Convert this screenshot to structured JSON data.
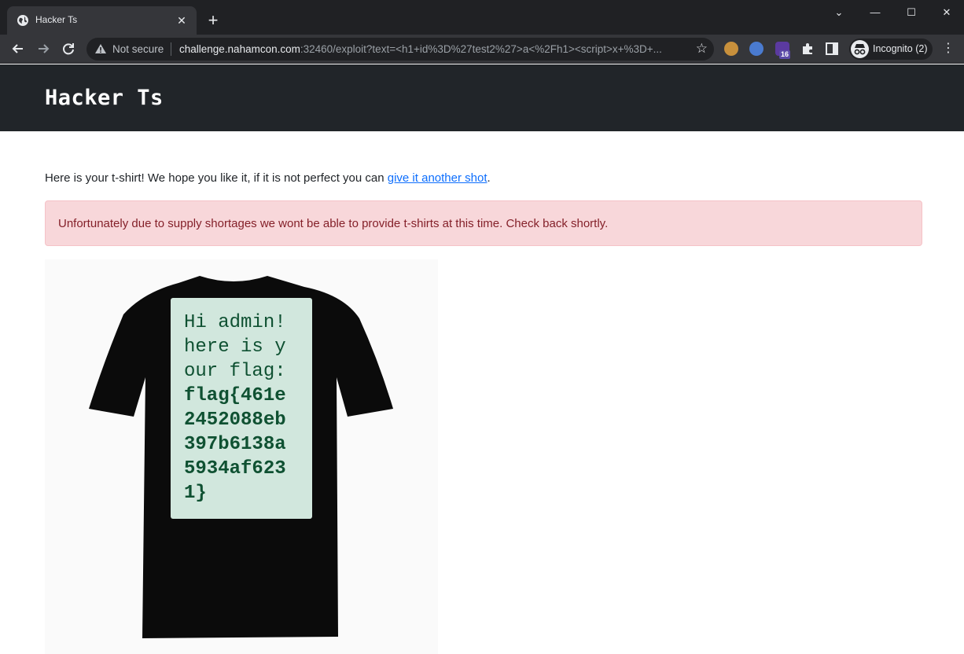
{
  "browser": {
    "tab_title": "Hacker Ts",
    "tab_close": "✕",
    "new_tab": "+",
    "window_controls": {
      "minimize": "—",
      "maximize": "☐",
      "close": "✕",
      "dropdown": "⌄"
    },
    "security_label": "Not secure",
    "url_host": "challenge.nahamcon.com",
    "url_rest": ":32460/exploit?text=<h1+id%3D%27test2%27>a<%2Fh1><script>x+%3D+...",
    "extension_badge": "16",
    "profile_label": "Incognito (2)",
    "icons": [
      "globe-icon",
      "back-arrow-icon",
      "forward-arrow-icon",
      "reload-icon",
      "warning-icon",
      "star-icon",
      "cookie-extension-icon",
      "globe-extension-icon",
      "hat-extension-icon",
      "puzzle-icon",
      "side-panel-icon",
      "incognito-icon",
      "menu-dots-icon"
    ]
  },
  "page": {
    "brand": "Hacker Ts",
    "intro_text": "Here is your t-shirt! We hope you like it, if it is not perfect you can ",
    "intro_link": "give it another shot",
    "intro_end": ".",
    "alert": "Unfortunately due to supply shortages we wont be able to provide t-shirts at this time. Check back shortly.",
    "shirt_lines": [
      "Hi admin!",
      "here is y",
      "our flag:"
    ],
    "flag_lines": [
      "flag{461e",
      "2452088eb",
      "397b6138a",
      "5934af623",
      "1}"
    ]
  },
  "colors": {
    "header_bg": "#212529",
    "alert_bg": "#f8d7da",
    "alert_text": "#842029",
    "link": "#0d6efd",
    "print_bg": "#d1e7dd",
    "print_text": "#0f5132"
  }
}
